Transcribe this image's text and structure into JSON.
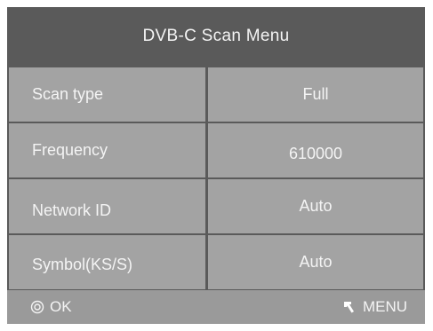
{
  "title": "DVB-C Scan Menu",
  "rows": [
    {
      "label": "Scan type",
      "value": "Full"
    },
    {
      "label": "Frequency",
      "value": "610000"
    },
    {
      "label": "Network ID",
      "value": "Auto"
    },
    {
      "label": "Symbol(KS/S)",
      "value": "Auto"
    }
  ],
  "footer": {
    "ok_label": "OK",
    "ok_icon": "ok-circle-icon",
    "menu_label": "MENU",
    "menu_icon": "back-arrow-icon"
  },
  "colors": {
    "panel": "#5a5a5a",
    "row": "#a3a3a3",
    "footer": "#9a9a9a",
    "text": "#f4f4f4"
  }
}
